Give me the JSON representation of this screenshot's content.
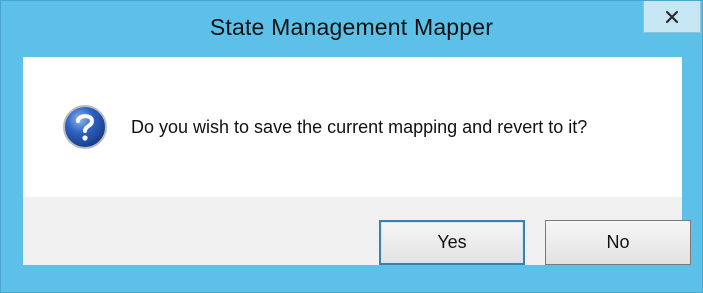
{
  "window": {
    "title": "State Management Mapper",
    "close_glyph": "✕"
  },
  "dialog": {
    "icon": "question-icon",
    "message": "Do you wish to save the current mapping and revert to it?"
  },
  "buttons": {
    "yes_label": "Yes",
    "no_label": "No"
  },
  "colors": {
    "title_bar": "#5cc0e8",
    "icon_blue": "#1f4fa8",
    "default_button_border": "#3c7fb1"
  }
}
